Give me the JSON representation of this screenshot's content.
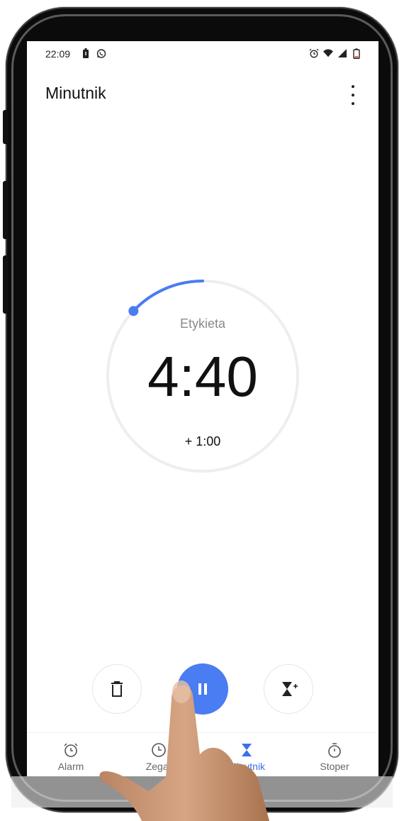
{
  "status_bar": {
    "time": "22:09",
    "left_icons": [
      "battery-saver-icon",
      "whatsapp-icon"
    ],
    "right_icons": [
      "alarm-icon",
      "wifi-icon",
      "signal-icon",
      "battery-icon"
    ]
  },
  "app_bar": {
    "title": "Minutnik",
    "more_icon": "more-vertical-icon"
  },
  "timer": {
    "label": "Etykieta",
    "remaining": "4:40",
    "add_time": "+ 1:00",
    "progress_fraction": 0.13,
    "accent_color": "#4a7cf2",
    "track_color": "#eeeeee"
  },
  "controls": {
    "delete_icon": "trash-icon",
    "pause_icon": "pause-icon",
    "add_timer_icon": "add-hourglass-icon"
  },
  "bottom_nav": {
    "items": [
      {
        "label": "Alarm",
        "icon": "alarm-clock-icon"
      },
      {
        "label": "Zegar",
        "icon": "clock-icon"
      },
      {
        "label": "Minutnik",
        "icon": "hourglass-icon",
        "active": true
      },
      {
        "label": "Stoper",
        "icon": "stopwatch-icon"
      }
    ],
    "active_color": "#3a6fe8"
  }
}
